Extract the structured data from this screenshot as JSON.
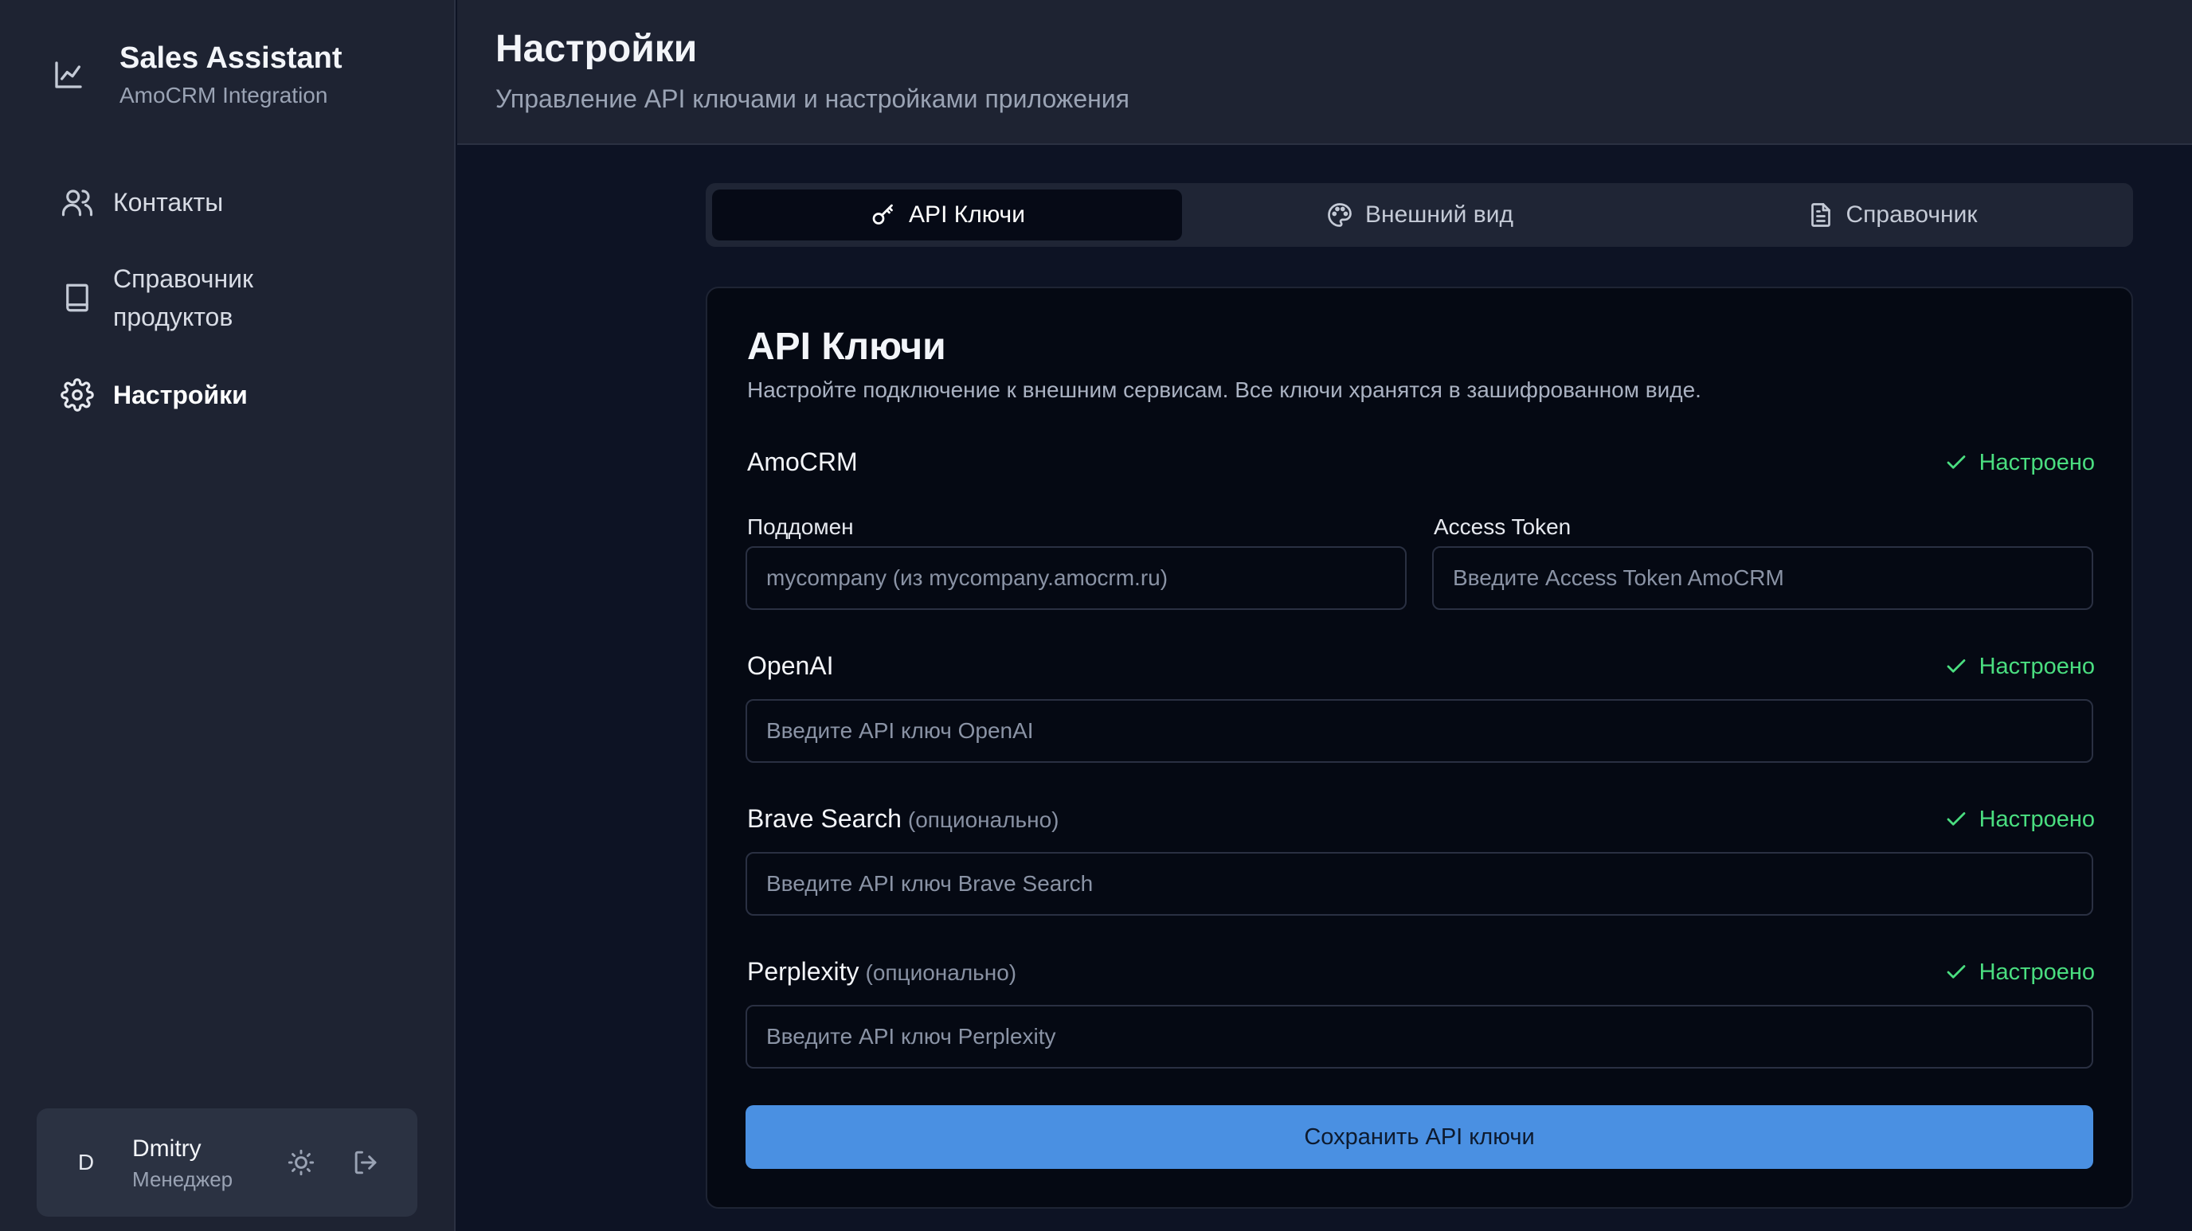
{
  "app": {
    "title": "Sales Assistant",
    "subtitle": "AmoCRM Integration"
  },
  "sidebar": {
    "items": [
      {
        "label": "Контакты",
        "icon": "users-icon",
        "active": false
      },
      {
        "label": "Справочник продуктов",
        "icon": "book-icon",
        "active": false
      },
      {
        "label": "Настройки",
        "icon": "gear-icon",
        "active": true
      }
    ]
  },
  "user": {
    "initial": "D",
    "name": "Dmitry",
    "role": "Менеджер"
  },
  "header": {
    "title": "Настройки",
    "subtitle": "Управление API ключами и настройками приложения"
  },
  "tabs": [
    {
      "label": "API Ключи",
      "icon": "key-icon",
      "active": true
    },
    {
      "label": "Внешний вид",
      "icon": "palette-icon",
      "active": false
    },
    {
      "label": "Справочник",
      "icon": "document-icon",
      "active": false
    }
  ],
  "card": {
    "title": "API Ключи",
    "description": "Настройте подключение к внешним сервисам. Все ключи хранятся в зашифрованном виде."
  },
  "sections": {
    "amocrm": {
      "title": "AmoCRM",
      "status": "Настроено",
      "subdomain_label": "Поддомен",
      "subdomain_placeholder": "mycompany (из mycompany.amocrm.ru)",
      "token_label": "Access Token",
      "token_placeholder": "Введите Access Token AmoCRM"
    },
    "openai": {
      "title": "OpenAI",
      "status": "Настроено",
      "placeholder": "Введите API ключ OpenAI"
    },
    "brave": {
      "title": "Brave Search",
      "optional": "(опционально)",
      "status": "Настроено",
      "placeholder": "Введите API ключ Brave Search"
    },
    "perplexity": {
      "title": "Perplexity",
      "optional": "(опционально)",
      "status": "Настроено",
      "placeholder": "Введите API ключ Perplexity"
    }
  },
  "save_label": "Сохранить API ключи",
  "colors": {
    "accent": "#4a90e2",
    "success": "#4ade80",
    "sidebar_bg": "#1e2332",
    "card_bg": "#050913"
  }
}
